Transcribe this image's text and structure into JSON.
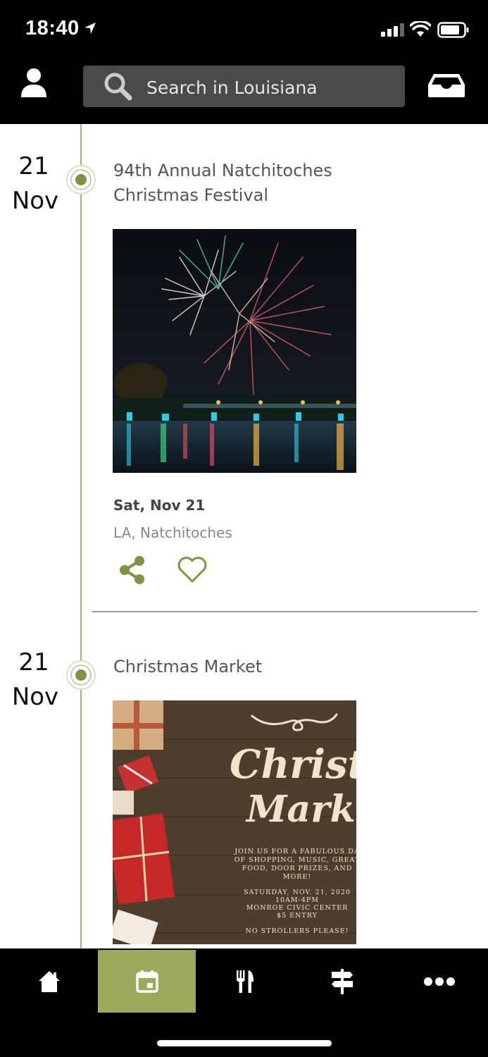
{
  "status_bar": {
    "time": "18:40"
  },
  "header": {
    "search_placeholder": "Search in Louisiana"
  },
  "events": [
    {
      "day": "21",
      "month": "Nov",
      "title": "94th Annual Natchitoches Christmas Festival",
      "date": "Sat, Nov 21",
      "location": "LA, Natchitoches",
      "image": "fireworks-over-river"
    },
    {
      "day": "21",
      "month": "Nov",
      "title": "Christmas Market",
      "image": "christmas-market-flyer",
      "flyer": {
        "heading1": "Christmas",
        "heading2": "Market",
        "line1": "JOIN US FOR A FABULOUS DA",
        "line2": "OF SHOPPING, MUSIC, GREAT",
        "line3": "FOOD, DOOR PRIZES, AND",
        "line4": "MORE!",
        "line5": "SATURDAY, NOV. 21, 2020",
        "line6": "10AM-4PM",
        "line7": "MONROE CIVIC CENTER",
        "line8": "$5 ENTRY",
        "line9": "NO STROLLERS PLEASE!"
      }
    }
  ],
  "tabs": [
    {
      "name": "home",
      "icon": "home-icon"
    },
    {
      "name": "events",
      "icon": "calendar-icon",
      "active": true
    },
    {
      "name": "dining",
      "icon": "fork-knife-icon"
    },
    {
      "name": "directions",
      "icon": "signpost-icon"
    },
    {
      "name": "more",
      "icon": "more-icon"
    }
  ],
  "colors": {
    "accent": "#9aa95a",
    "timeline": "#a8b274",
    "icon_green": "#7d9440"
  }
}
